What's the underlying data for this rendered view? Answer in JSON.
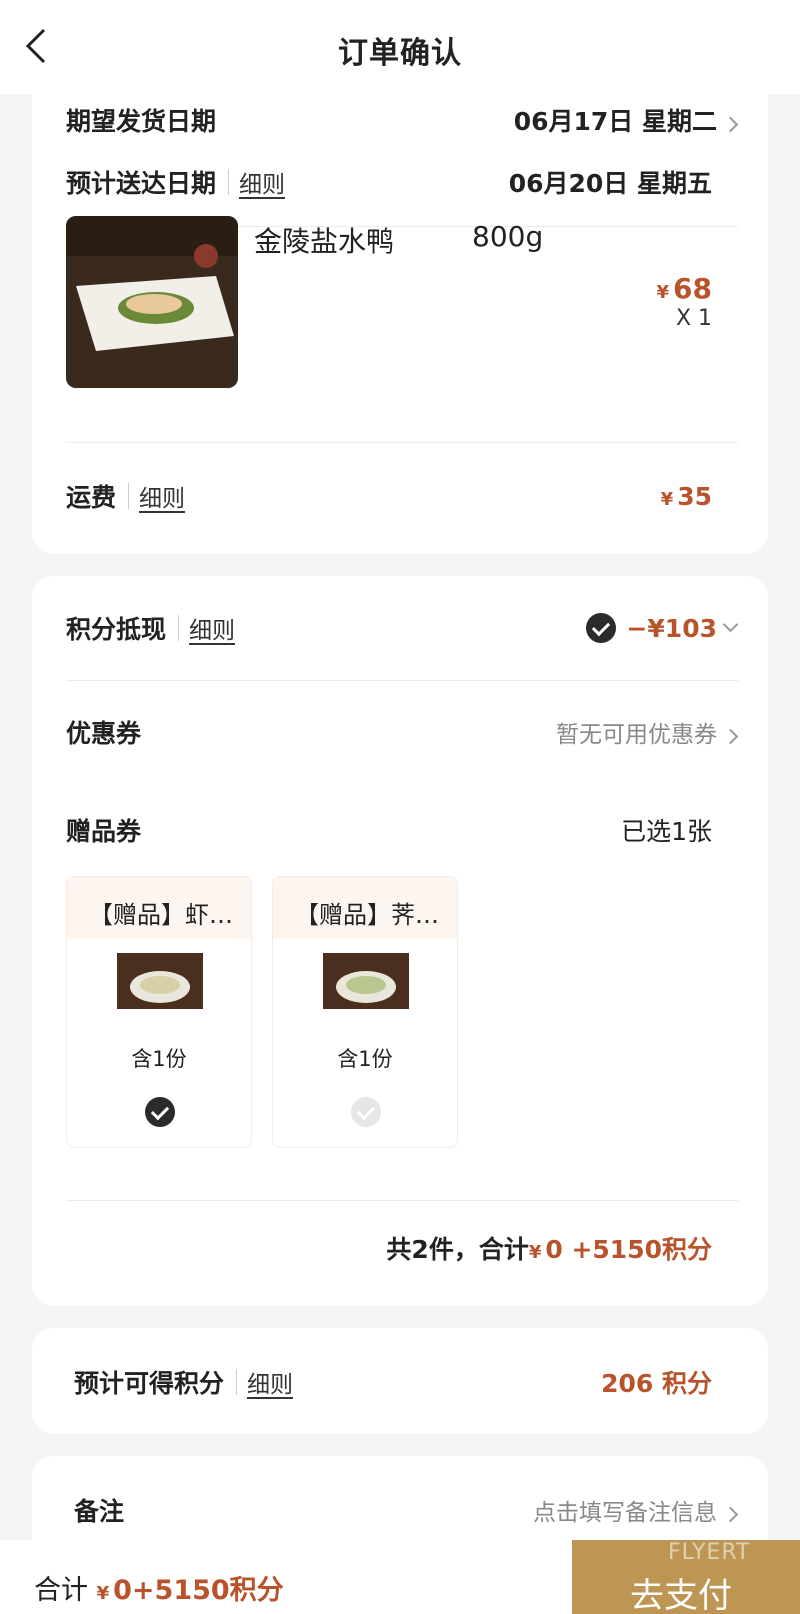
{
  "header": {
    "title": "订单确认"
  },
  "shipping": {
    "expected_ship_label": "期望发货日期",
    "expected_ship_value": "06月17日  星期二",
    "expected_arrive_label": "预计送达日期",
    "rules_link": "细则",
    "expected_arrive_value": "06月20日  星期五"
  },
  "product": {
    "name": "金陵盐水鸭",
    "weight": "800g",
    "currency": "¥",
    "price": "68",
    "quantity": "X 1"
  },
  "freight": {
    "label": "运费",
    "rules_link": "细则",
    "currency": "¥",
    "value": "35"
  },
  "points_deduction": {
    "label": "积分抵现",
    "rules_link": "细则",
    "value": "−¥103",
    "checked": true
  },
  "coupon": {
    "label": "优惠券",
    "value": "暂无可用优惠券"
  },
  "gift_coupons": {
    "label": "赠品券",
    "selected": "已选1张",
    "items": [
      {
        "title": "【赠品】虾…",
        "qty": "含1份",
        "selected": true
      },
      {
        "title": "【赠品】荠…",
        "qty": "含1份",
        "selected": false
      }
    ]
  },
  "summary": {
    "prefix": "共2件，合计",
    "currency": "¥",
    "amount": "0 +5150积分"
  },
  "earn_points": {
    "label": "预计可得积分",
    "rules_link": "细则",
    "value": "206 积分"
  },
  "remark": {
    "label": "备注",
    "placeholder": "点击填写备注信息"
  },
  "footer": {
    "total_label": "合计",
    "currency": "¥",
    "total_value": "0+5150积分",
    "pay_button": "去支付",
    "watermark": "FLYERT"
  },
  "colors": {
    "accent": "#b8532b",
    "pay_button": "#bd9654",
    "background": "#f5f5f7"
  }
}
